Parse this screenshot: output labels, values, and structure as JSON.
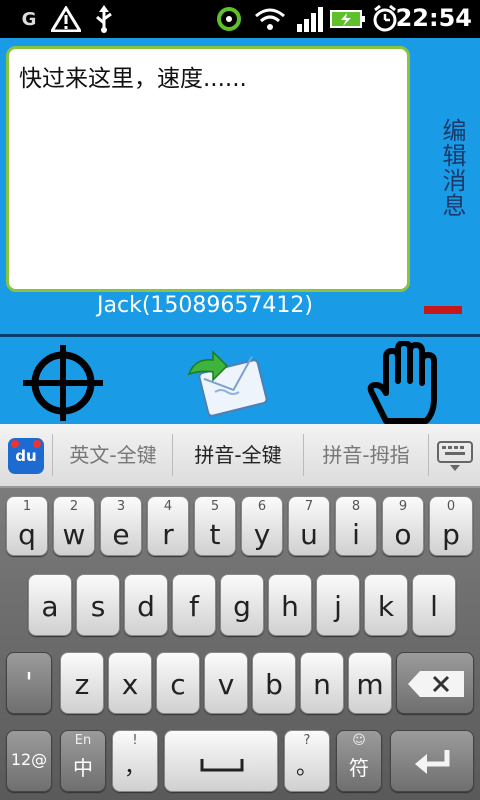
{
  "status_bar": {
    "time": "22:54",
    "icons": [
      "g-carrier-icon",
      "warning-icon",
      "usb-icon",
      "location-icon",
      "wifi-icon",
      "signal-icon",
      "battery-icon",
      "alarm-icon"
    ]
  },
  "app": {
    "message_text": "快过来这里，速度......",
    "side_label": "编辑消息",
    "contact_line": "Jack(15089657412)",
    "colors": {
      "background": "#1a9be6",
      "textbox_border": "#8ac43f",
      "red_bar": "#c4181a"
    },
    "tools": [
      "crosshair-icon",
      "send-mail-icon",
      "hand-icon"
    ]
  },
  "ime": {
    "logo_label": "du",
    "modes": [
      "英文-全键",
      "拼音-全键",
      "拼音-拇指"
    ],
    "active_mode": "拼音-全键",
    "keyboard_toggle_icon": "keyboard-icon"
  },
  "keyboard": {
    "row1": [
      {
        "num": "1",
        "letter": "q"
      },
      {
        "num": "2",
        "letter": "w"
      },
      {
        "num": "3",
        "letter": "e"
      },
      {
        "num": "4",
        "letter": "r"
      },
      {
        "num": "5",
        "letter": "t"
      },
      {
        "num": "6",
        "letter": "y"
      },
      {
        "num": "7",
        "letter": "u"
      },
      {
        "num": "8",
        "letter": "i"
      },
      {
        "num": "9",
        "letter": "o"
      },
      {
        "num": "0",
        "letter": "p"
      }
    ],
    "row2": [
      "a",
      "s",
      "d",
      "f",
      "g",
      "h",
      "j",
      "k",
      "l"
    ],
    "row3": [
      "'",
      "z",
      "x",
      "c",
      "v",
      "b",
      "n",
      "m"
    ],
    "row4": {
      "sym_label": "12@",
      "lang_top": "En",
      "lang_bottom": "中",
      "comma_top": "!",
      "comma": "，",
      "period_top": "?",
      "period": "。",
      "smiley": "☺",
      "fu": "符"
    }
  }
}
